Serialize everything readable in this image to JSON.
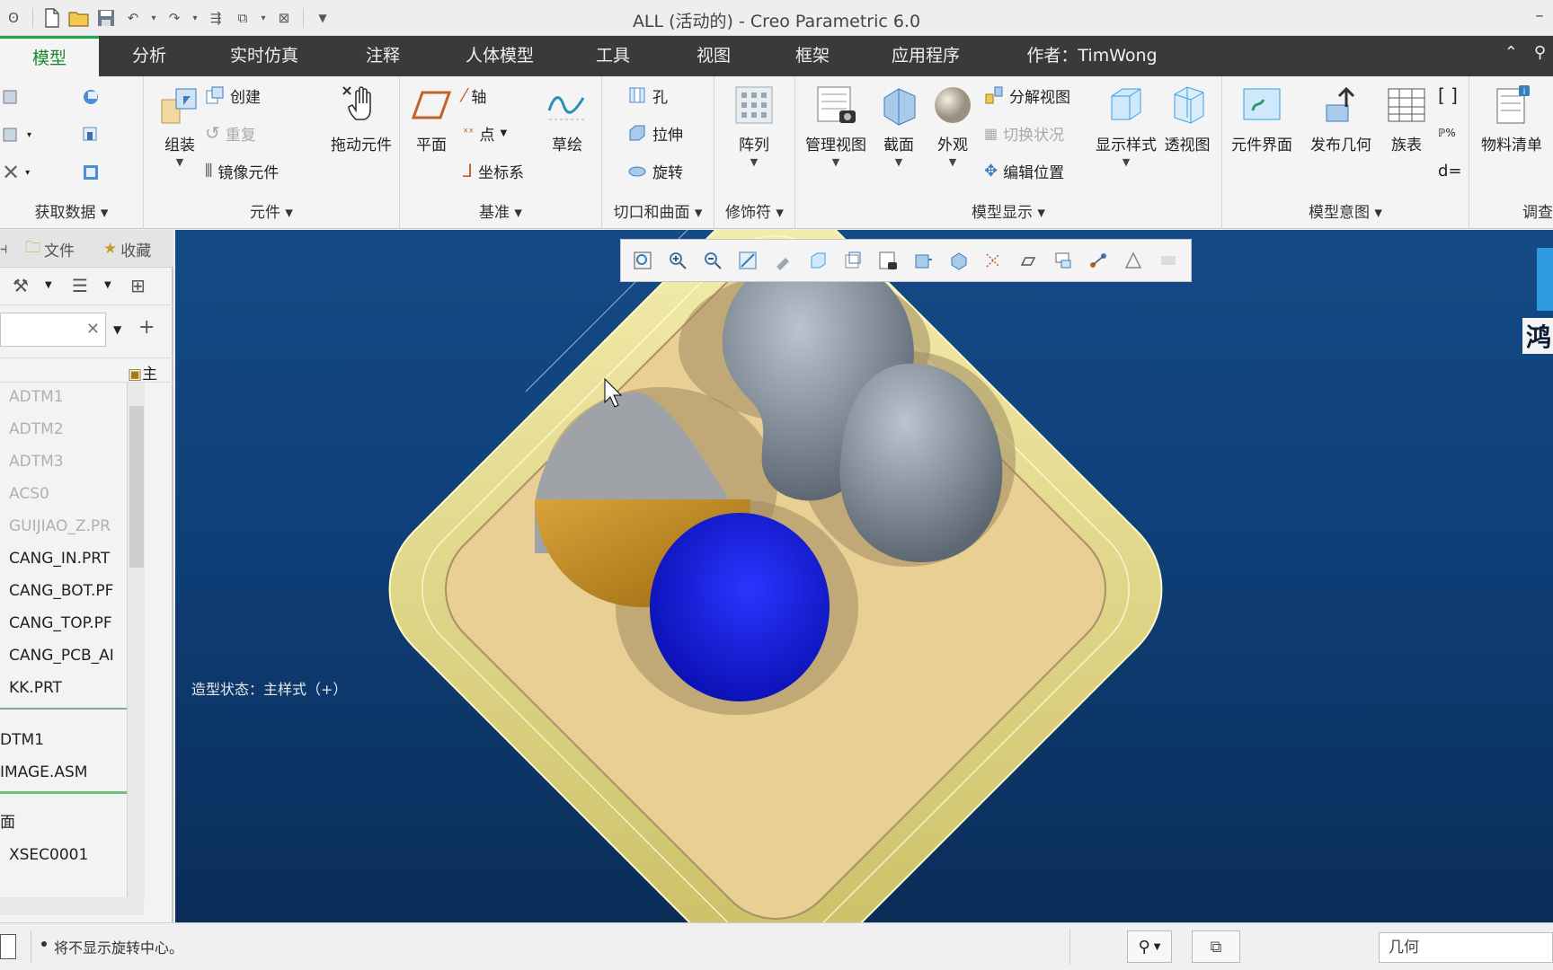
{
  "window": {
    "title": "ALL (活动的) - Creo Parametric 6.0"
  },
  "quick_access": {
    "items": [
      "new-icon",
      "open-icon",
      "save-icon",
      "undo-icon",
      "redo-icon",
      "regenerate-icon",
      "window-icon",
      "close-icon",
      "customize-icon"
    ]
  },
  "tabs": [
    {
      "label": "模型",
      "active": true
    },
    {
      "label": "分析"
    },
    {
      "label": "实时仿真"
    },
    {
      "label": "注释"
    },
    {
      "label": "人体模型"
    },
    {
      "label": "工具"
    },
    {
      "label": "视图"
    },
    {
      "label": "框架"
    },
    {
      "label": "应用程序"
    },
    {
      "label": "作者：TimWong"
    }
  ],
  "ribbon": {
    "get_data": {
      "label": "获取数据 ▾"
    },
    "components": {
      "label": "元件 ▾",
      "assemble": "组装",
      "create": "创建",
      "repeat": "重复",
      "mirror": "镜像元件",
      "drag": "拖动元件"
    },
    "datum": {
      "label": "基准 ▾",
      "plane": "平面",
      "axis": "轴",
      "point": "点",
      "csys": "坐标系",
      "sketch": "草绘"
    },
    "cut_surface": {
      "label": "切口和曲面 ▾",
      "hole": "孔",
      "extrude": "拉伸",
      "revolve": "旋转"
    },
    "modifiers": {
      "label": "修饰符 ▾",
      "pattern": "阵列"
    },
    "model_display": {
      "label": "模型显示 ▾",
      "manage_views": "管理视图",
      "section": "截面",
      "appearance": "外观",
      "exploded": "分解视图",
      "toggle_status": "切换状况",
      "edit_position": "编辑位置",
      "display_style": "显示样式",
      "perspective": "透视图"
    },
    "model_intent": {
      "label": "模型意图 ▾",
      "component_interface": "元件界面",
      "publish_geometry": "发布几何",
      "family_table": "族表",
      "d_equals": "d="
    },
    "investigate": {
      "label": "调查",
      "bom": "物料清单"
    }
  },
  "left_panel": {
    "tabs": [
      "文件",
      "收藏"
    ],
    "settings_label": "主",
    "tree_items": [
      {
        "label": "ADTM1",
        "dim": true
      },
      {
        "label": "ADTM2",
        "dim": true
      },
      {
        "label": "ADTM3",
        "dim": true
      },
      {
        "label": "ACS0",
        "dim": true
      },
      {
        "label": "GUIJIAO_Z.PR",
        "dim": true
      },
      {
        "label": "CANG_IN.PRT"
      },
      {
        "label": "CANG_BOT.PF"
      },
      {
        "label": "CANG_TOP.PF"
      },
      {
        "label": "CANG_PCB_AI"
      },
      {
        "label": "KK.PRT"
      },
      {
        "label": "DTM1"
      },
      {
        "label": "IMAGE.ASM"
      },
      {
        "label": "面"
      },
      {
        "label": "XSEC0001"
      }
    ]
  },
  "viewport": {
    "display_state": "造型状态：主样式（+）",
    "watermark": "鸿",
    "toolbar_icons": [
      "refit-icon",
      "zoom-in-icon",
      "zoom-out-icon",
      "repaint-icon",
      "pan-icon",
      "display-style-icon",
      "saved-views-icon",
      "view-manager-icon",
      "section-icon",
      "appearance-icon",
      "datum-display-icon",
      "spin-center-icon",
      "annotation-icon",
      "layer-icon",
      "snap-icon",
      "warning-icon",
      "notes-icon"
    ],
    "colors": {
      "bg_top": "#144a86",
      "bg_bottom": "#0a2d58",
      "housing": "#e8dd8a",
      "tray": "#e9cf93",
      "gray_part": "#8f9aa5",
      "blue_part": "#0a10e8",
      "gold_part": "#c98d1c"
    }
  },
  "statusbar": {
    "message": "将不显示旋转中心。",
    "filter": "几何"
  }
}
